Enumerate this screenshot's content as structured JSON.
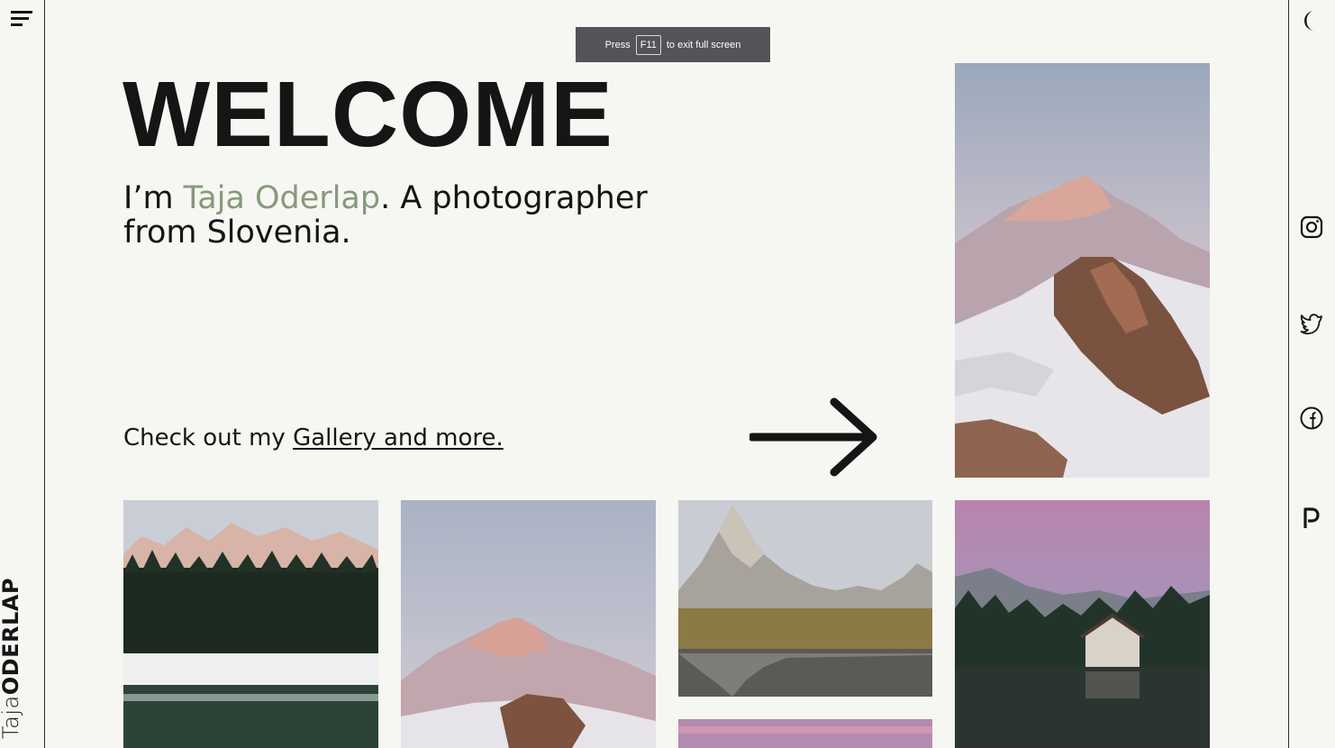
{
  "window": {
    "fullscreen_toast": {
      "prefix": "Press",
      "key": "F11",
      "suffix": "to exit full screen"
    }
  },
  "sidebar": {
    "menu_icon": "menu-icon",
    "brand_first": "Taja",
    "brand_last": "ODERLAP"
  },
  "social": {
    "theme_toggle_icon": "moon-icon",
    "items": [
      "instagram-icon",
      "twitter-icon",
      "facebook-icon",
      "pinterest-icon"
    ]
  },
  "hero": {
    "title": "WELCOME",
    "intro_prefix": "I’m ",
    "intro_name": "Taja Oderlap",
    "intro_suffix": ". A photographer from Slovenia.",
    "cta_prefix": "Check out my ",
    "cta_link": "Gallery and more.",
    "arrow_icon": "arrow-right-icon"
  },
  "colors": {
    "background": "#f6f6f2",
    "accent_name": "#859a7c",
    "text": "#151515",
    "toast_bg": "#525458"
  }
}
